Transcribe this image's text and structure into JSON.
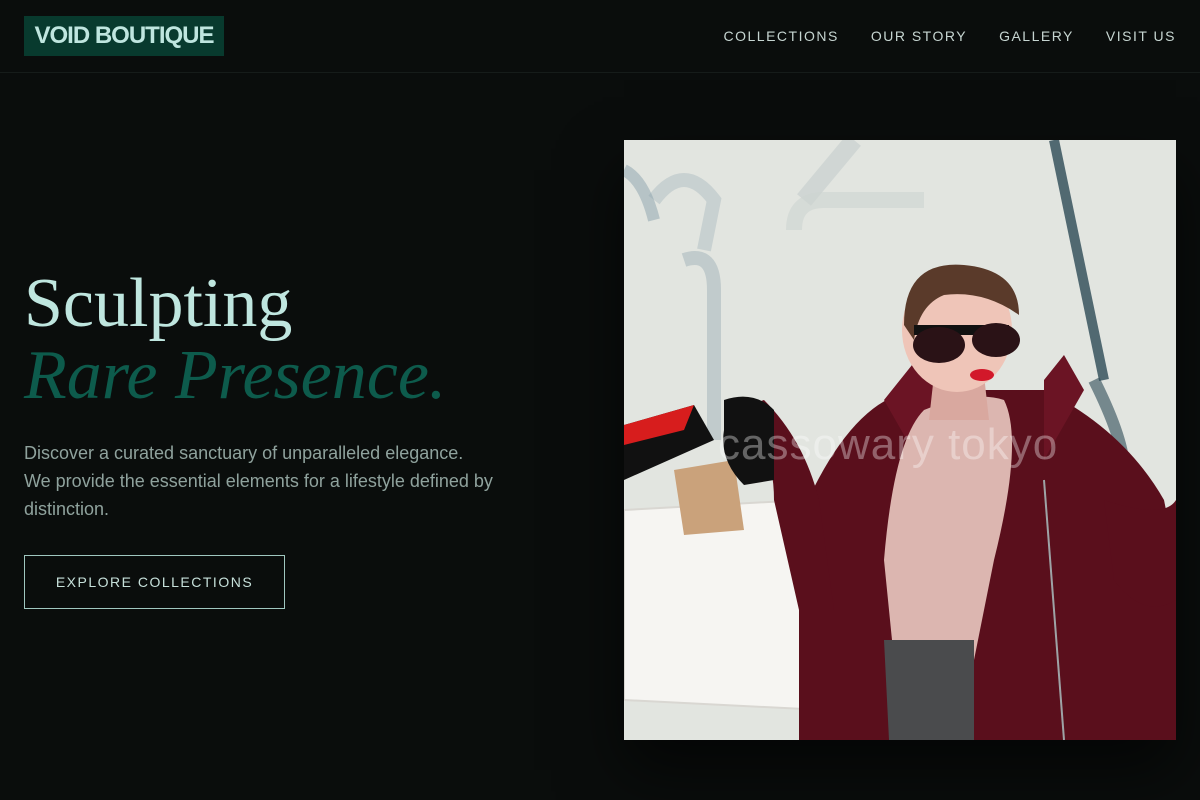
{
  "brand": {
    "logo": "VOID BOUTIQUE"
  },
  "nav": {
    "items": [
      {
        "label": "COLLECTIONS"
      },
      {
        "label": "OUR STORY"
      },
      {
        "label": "GALLERY"
      },
      {
        "label": "VISIT US"
      }
    ]
  },
  "hero": {
    "title_line1": "Sculpting",
    "title_line2": "Rare Presence.",
    "description": "Discover a curated sanctuary of unparalleled elegance. We provide the essential elements for a lifestyle defined by distinction.",
    "cta_label": "EXPLORE COLLECTIONS"
  },
  "image": {
    "watermark": "cassowary tokyo"
  },
  "colors": {
    "background": "#0a0d0c",
    "accent_light": "#bfe6df",
    "accent_dark": "#0d5b4c",
    "logo_bg": "#083a2e"
  }
}
